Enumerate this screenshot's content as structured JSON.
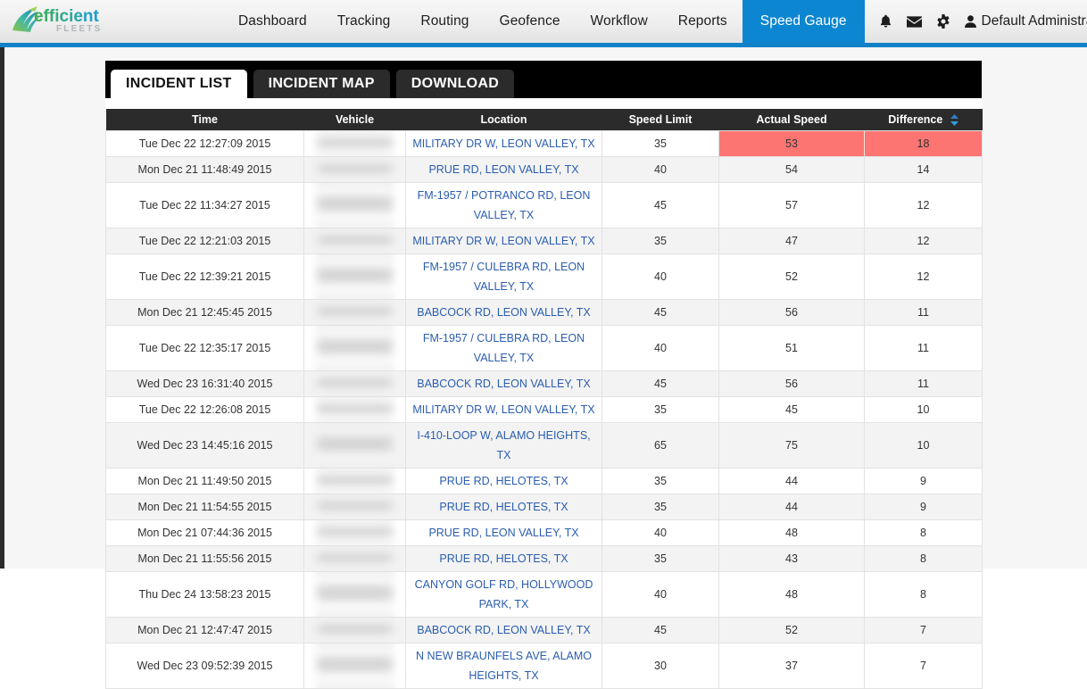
{
  "brand": {
    "name": "efficient",
    "sub": "FLEETS"
  },
  "nav": {
    "items": [
      {
        "label": "Dashboard",
        "active": false
      },
      {
        "label": "Tracking",
        "active": false
      },
      {
        "label": "Routing",
        "active": false
      },
      {
        "label": "Geofence",
        "active": false
      },
      {
        "label": "Workflow",
        "active": false
      },
      {
        "label": "Reports",
        "active": false
      },
      {
        "label": "Speed Gauge",
        "active": true
      }
    ],
    "icons": [
      {
        "name": "bell-icon",
        "glyph": "★"
      },
      {
        "name": "envelope-icon",
        "glyph": "✉"
      },
      {
        "name": "gear-icon",
        "glyph": "⚙"
      }
    ],
    "user": "Default Administrator",
    "user_icon": "👤"
  },
  "tabs": [
    {
      "label": "INCIDENT LIST",
      "active": true
    },
    {
      "label": "INCIDENT MAP",
      "active": false
    },
    {
      "label": "DOWNLOAD",
      "active": false
    }
  ],
  "table": {
    "columns": [
      "Time",
      "Vehicle",
      "Location",
      "Speed Limit",
      "Actual Speed",
      "Difference"
    ],
    "sorted_column": "Difference",
    "sort_direction": "desc",
    "highlight_color": "#fc7572",
    "rows": [
      {
        "time": "Tue Dec 22 12:27:09 2015",
        "vehicle": "",
        "location": "MILITARY DR W, LEON VALLEY, TX",
        "speed_limit": "35",
        "actual_speed": "53",
        "difference": "18",
        "highlighted": true
      },
      {
        "time": "Mon Dec 21 11:48:49 2015",
        "vehicle": "",
        "location": "PRUE RD, LEON VALLEY, TX",
        "speed_limit": "40",
        "actual_speed": "54",
        "difference": "14",
        "highlighted": false
      },
      {
        "time": "Tue Dec 22 11:34:27 2015",
        "vehicle": "",
        "location": "FM-1957 / POTRANCO RD, LEON VALLEY, TX",
        "speed_limit": "45",
        "actual_speed": "57",
        "difference": "12",
        "highlighted": false
      },
      {
        "time": "Tue Dec 22 12:21:03 2015",
        "vehicle": "",
        "location": "MILITARY DR W, LEON VALLEY, TX",
        "speed_limit": "35",
        "actual_speed": "47",
        "difference": "12",
        "highlighted": false
      },
      {
        "time": "Tue Dec 22 12:39:21 2015",
        "vehicle": "",
        "location": "FM-1957 / CULEBRA RD, LEON VALLEY, TX",
        "speed_limit": "40",
        "actual_speed": "52",
        "difference": "12",
        "highlighted": false
      },
      {
        "time": "Mon Dec 21 12:45:45 2015",
        "vehicle": "",
        "location": "BABCOCK RD, LEON VALLEY, TX",
        "speed_limit": "45",
        "actual_speed": "56",
        "difference": "11",
        "highlighted": false
      },
      {
        "time": "Tue Dec 22 12:35:17 2015",
        "vehicle": "",
        "location": "FM-1957 / CULEBRA RD, LEON VALLEY, TX",
        "speed_limit": "40",
        "actual_speed": "51",
        "difference": "11",
        "highlighted": false
      },
      {
        "time": "Wed Dec 23 16:31:40 2015",
        "vehicle": "",
        "location": "BABCOCK RD, LEON VALLEY, TX",
        "speed_limit": "45",
        "actual_speed": "56",
        "difference": "11",
        "highlighted": false
      },
      {
        "time": "Tue Dec 22 12:26:08 2015",
        "vehicle": "",
        "location": "MILITARY DR W, LEON VALLEY, TX",
        "speed_limit": "35",
        "actual_speed": "45",
        "difference": "10",
        "highlighted": false
      },
      {
        "time": "Wed Dec 23 14:45:16 2015",
        "vehicle": "",
        "location": "I-410-LOOP W, ALAMO HEIGHTS, TX",
        "speed_limit": "65",
        "actual_speed": "75",
        "difference": "10",
        "highlighted": false
      },
      {
        "time": "Mon Dec 21 11:49:50 2015",
        "vehicle": "",
        "location": "PRUE RD, HELOTES, TX",
        "speed_limit": "35",
        "actual_speed": "44",
        "difference": "9",
        "highlighted": false
      },
      {
        "time": "Mon Dec 21 11:54:55 2015",
        "vehicle": "",
        "location": "PRUE RD, HELOTES, TX",
        "speed_limit": "35",
        "actual_speed": "44",
        "difference": "9",
        "highlighted": false
      },
      {
        "time": "Mon Dec 21 07:44:36 2015",
        "vehicle": "",
        "location": "PRUE RD, LEON VALLEY, TX",
        "speed_limit": "40",
        "actual_speed": "48",
        "difference": "8",
        "highlighted": false
      },
      {
        "time": "Mon Dec 21 11:55:56 2015",
        "vehicle": "",
        "location": "PRUE RD, HELOTES, TX",
        "speed_limit": "35",
        "actual_speed": "43",
        "difference": "8",
        "highlighted": false
      },
      {
        "time": "Thu Dec 24 13:58:23 2015",
        "vehicle": "",
        "location": "CANYON GOLF RD, HOLLYWOOD PARK, TX",
        "speed_limit": "40",
        "actual_speed": "48",
        "difference": "8",
        "highlighted": false
      },
      {
        "time": "Mon Dec 21 12:47:47 2015",
        "vehicle": "",
        "location": "BABCOCK RD, LEON VALLEY, TX",
        "speed_limit": "45",
        "actual_speed": "52",
        "difference": "7",
        "highlighted": false
      },
      {
        "time": "Wed Dec 23 09:52:39 2015",
        "vehicle": "",
        "location": "N NEW BRAUNFELS AVE, ALAMO HEIGHTS, TX",
        "speed_limit": "30",
        "actual_speed": "37",
        "difference": "7",
        "highlighted": false
      }
    ]
  }
}
